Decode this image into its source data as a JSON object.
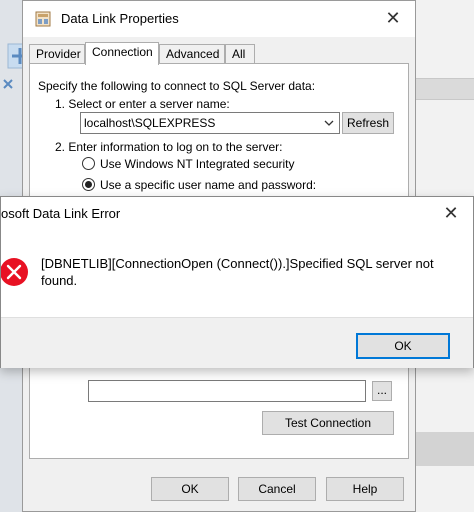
{
  "data_link": {
    "title": "Data Link Properties",
    "tabs": [
      "Provider",
      "Connection",
      "Advanced",
      "All"
    ],
    "active_tab": "Connection",
    "intro": "Specify the following to connect to SQL Server data:",
    "step1": "1. Select or enter a server name:",
    "server_value": "localhost\\SQLEXPRESS",
    "refresh_label": "Refresh",
    "step2": "2. Enter information to log on to the server:",
    "radio_windows": "Use Windows NT Integrated security",
    "radio_specific": "Use a specific user name and password:",
    "browse_label": "...",
    "test_connection_label": "Test Connection",
    "ok_label": "OK",
    "cancel_label": "Cancel",
    "help_label": "Help"
  },
  "error_dialog": {
    "title": "osoft Data Link Error",
    "message": "[DBNETLIB][ConnectionOpen (Connect()).]Specified SQL server not found.",
    "ok_label": "OK"
  },
  "colors": {
    "accent": "#0078d7",
    "error_icon": "#e81123"
  }
}
